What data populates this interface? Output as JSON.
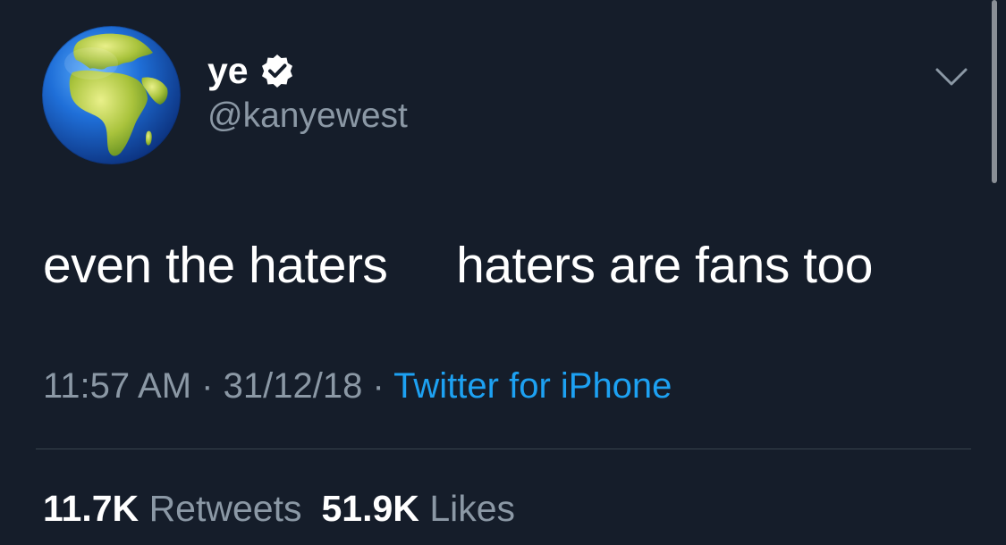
{
  "user": {
    "display_name": "ye",
    "handle": "@kanyewest",
    "verified": true,
    "avatar_icon": "globe-europe-africa-icon"
  },
  "tweet": {
    "text": "even the haters     haters are fans too"
  },
  "meta": {
    "time": "11:57 AM",
    "date": "31/12/18",
    "separator": "·",
    "source": "Twitter for iPhone"
  },
  "stats": {
    "retweets_count": "11.7K",
    "retweets_label": "Retweets",
    "likes_count": "51.9K",
    "likes_label": "Likes"
  },
  "colors": {
    "background": "#151d2a",
    "primary_text": "#ffffff",
    "secondary_text": "#8b98a5",
    "link": "#1da1f2",
    "divider": "#38444d"
  }
}
